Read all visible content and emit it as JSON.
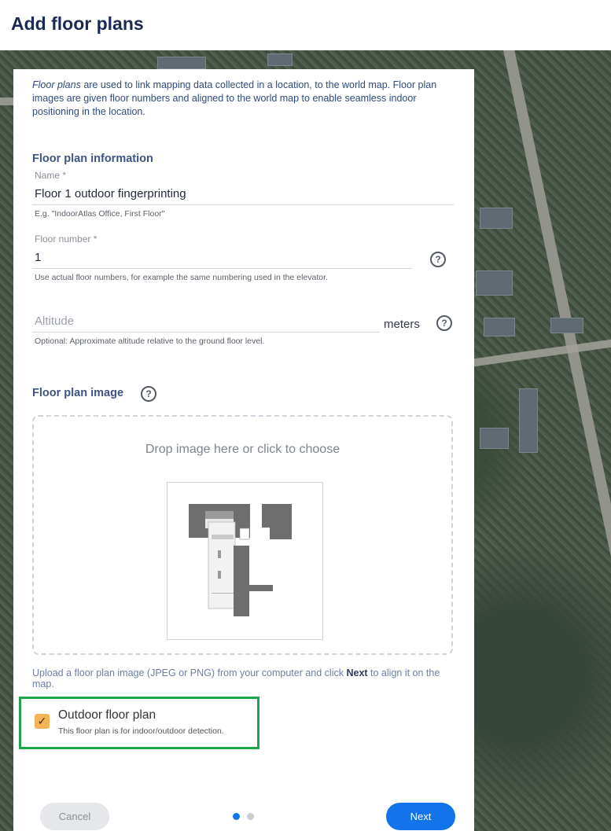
{
  "header": {
    "title": "Add floor plans"
  },
  "intro": {
    "lead_italic": "Floor plans",
    "text": " are used to link mapping data collected in a location, to the world map. Floor plan images are given floor numbers and aligned to the world map to enable seamless indoor positioning in the location."
  },
  "info_section": {
    "title": "Floor plan information"
  },
  "name_field": {
    "label": "Name *",
    "value": "Floor 1 outdoor fingerprinting",
    "hint": "E.g. \"IndoorAtlas Office, First Floor\""
  },
  "floor_field": {
    "label": "Floor number *",
    "value": "1",
    "hint": "Use actual floor numbers, for example the same numbering used in the elevator."
  },
  "altitude_field": {
    "placeholder": "Altitude",
    "unit": "meters",
    "hint": "Optional: Approximate altitude relative to the ground floor level."
  },
  "image_section": {
    "title": "Floor plan image"
  },
  "dropzone": {
    "text": "Drop image here or click to choose"
  },
  "upload_hint": {
    "before": "Upload a floor plan image (JPEG or PNG) from your computer and click ",
    "bold": "Next",
    "after": " to align it on the map."
  },
  "outdoor": {
    "title": "Outdoor floor plan",
    "description": "This floor plan is for indoor/outdoor detection.",
    "checked": true,
    "highlight_color": "#1fa64a",
    "checkbox_color": "#f4b455"
  },
  "footer": {
    "cancel_label": "Cancel",
    "next_label": "Next",
    "steps_total": 2,
    "step_current": 1
  },
  "colors": {
    "primary": "#1273eb",
    "heading": "#1b2a55"
  }
}
